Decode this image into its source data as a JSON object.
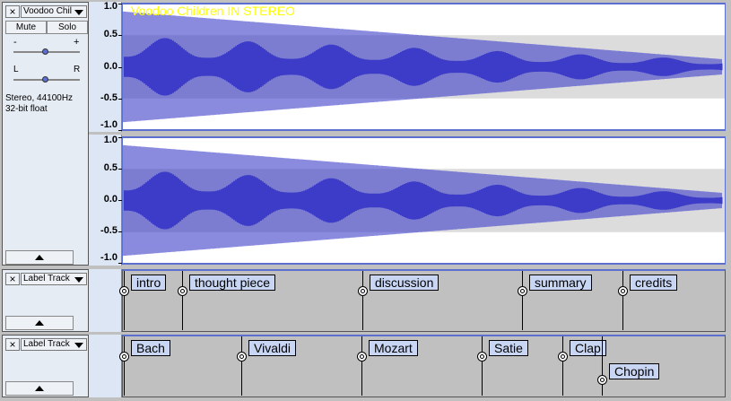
{
  "audio_track": {
    "name": "Voodoo Chil",
    "waveform_title": "Voodoo Children IN STEREO",
    "mute_label": "Mute",
    "solo_label": "Solo",
    "gain_minus": "-",
    "gain_plus": "+",
    "pan_left": "L",
    "pan_right": "R",
    "info_line1": "Stereo, 44100Hz",
    "info_line2": "32-bit float",
    "scale_ticks": [
      "1.0",
      "0.5",
      "0.0",
      "-0.5",
      "-1.0"
    ],
    "colors": {
      "waveform": "#3c3cc8",
      "title": "#ffff00",
      "background": "#ffffff",
      "band": "#dcdcdc"
    }
  },
  "label_track_1": {
    "name": "Label Track",
    "labels": [
      "intro",
      "thought piece",
      "discussion",
      "summary",
      "credits"
    ]
  },
  "label_track_2": {
    "name": "Label Track",
    "labels": [
      "Bach",
      "Vivaldi",
      "Mozart",
      "Satie",
      "Clap",
      "Chopin"
    ]
  },
  "icons": {
    "close": "×"
  }
}
